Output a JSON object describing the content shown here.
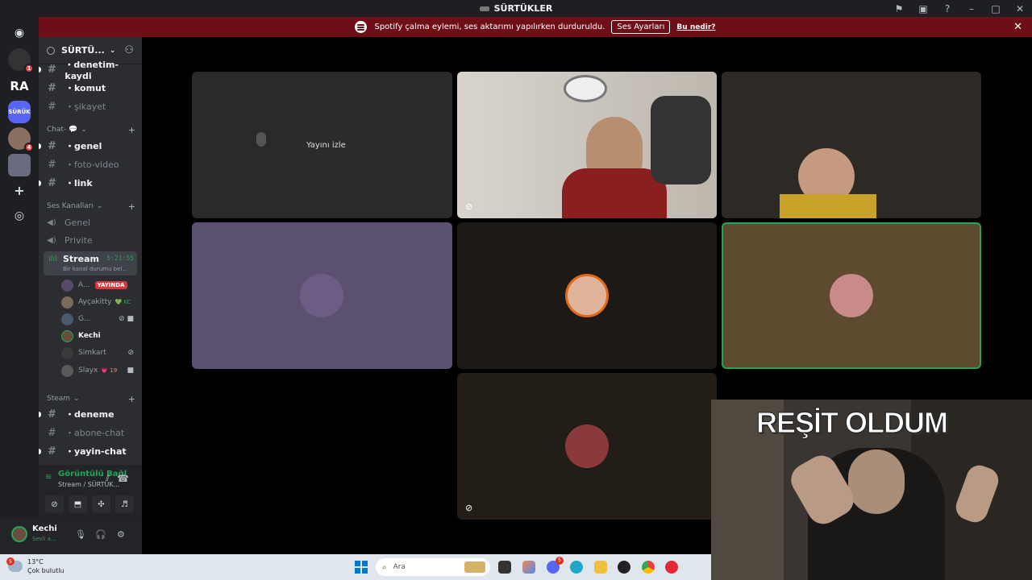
{
  "window": {
    "title": "SÜRTÜKLER"
  },
  "banner": {
    "message": "Spotify çalma eylemi, ses aktarımı yapılırken durduruldu.",
    "button": "Ses Ayarları",
    "link": "Bu nedir?"
  },
  "guilds": {
    "ra_label": "RA",
    "surtuk_label": "SÜRÜK",
    "badges": [
      "1",
      "4"
    ]
  },
  "server": {
    "name": "SÜRTÜ...",
    "categories": {
      "chat": "Chat- 💬",
      "voice": "Ses Kanalları",
      "steam": "Steam"
    },
    "top_channels": [
      "・denetim-kaydi",
      "・komut",
      "・şikayet"
    ],
    "chat_channels": [
      "・genel",
      "・foto-video",
      "・link"
    ],
    "voice_channels": [
      "Genel",
      "Privite"
    ],
    "steam_channels": [
      "・deneme",
      "・abone-chat",
      "・yayin-chat"
    ]
  },
  "stream_channel": {
    "name": "Stream",
    "timer": "5:21:55",
    "status": "Bir kanal durumu bel..."
  },
  "voice_users": [
    {
      "name": "A...",
      "badge": "YAYINDA",
      "color": "#5a4a6a"
    },
    {
      "name": "Ayçakitty",
      "status": "💚 KC",
      "color": "#7a6a5a"
    },
    {
      "name": "G...",
      "color": "#4a5a6a"
    },
    {
      "name": "Kechi",
      "color": "#6b4b3b"
    },
    {
      "name": "Simkart",
      "color": "#3a3a3a"
    },
    {
      "name": "Slayx",
      "status": "💗 19",
      "color": "#5a5a5a"
    }
  ],
  "voice_panel": {
    "connected": "Görüntülü Bağl",
    "sub": "Stream / SÜRTÜK..."
  },
  "user": {
    "name": "Kechi",
    "status": "Sesli a..."
  },
  "stage": {
    "watch_label": "Yayını izle",
    "tile_colors": {
      "purple": "#5c5070",
      "brown": "#5e4a2e",
      "dark": "#1c1917",
      "dark2": "#221d16"
    },
    "cam_overlay": "REŞİT OLDUM"
  },
  "taskbar": {
    "temp": "13°C",
    "weather": "Çok bulutlu",
    "weather_badge": "5",
    "search": "Ara",
    "discord_badge": "5"
  },
  "colors": {
    "accent_green": "#23a559",
    "banner_red": "#6e0e16",
    "live_red": "#da373c"
  }
}
